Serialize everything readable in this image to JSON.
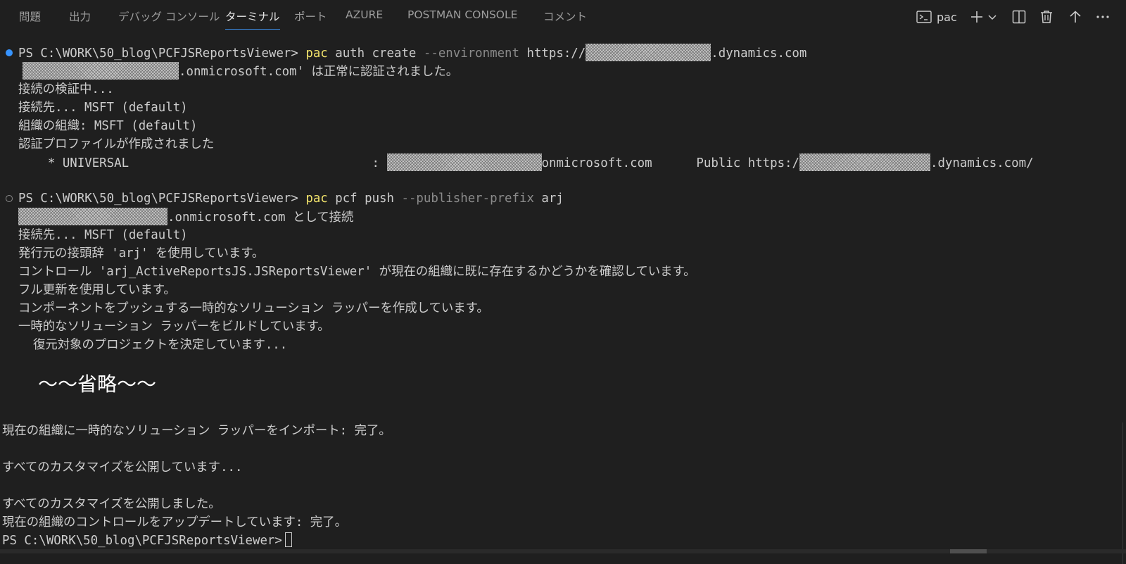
{
  "tabs": {
    "problems": "問題",
    "output": "出力",
    "debug_console": "デバッグ コンソール",
    "terminal": "ターミナル",
    "ports": "ポート",
    "azure": "AZURE",
    "postman_console": "POSTMAN CONSOLE",
    "comments": "コメント",
    "active": "terminal"
  },
  "toolbar": {
    "terminal_name": "pac",
    "icons": [
      "terminal-icon",
      "plus-icon",
      "chevron-down-icon",
      "split-icon",
      "trash-icon",
      "arrow-up-icon",
      "more-icon"
    ]
  },
  "terminal": {
    "block1": {
      "prompt": "PS C:\\WORK\\50_blog\\PCFJSReportsViewer> ",
      "cmd_exe": "pac",
      "cmd_rest": " auth create ",
      "cmd_param": "--environment",
      "url_prefix": " https://",
      "url_suffix": ".dynamics.com",
      "auth_suffix": ".onmicrosoft.com' は正常に認証されました。",
      "verifying": "接続の検証中...",
      "connected_to": "接続先... MSFT (default)",
      "org": "組織の組織: MSFT (default)",
      "profile_created": "認証プロファイルが作成されました",
      "profile_prefix": "    * UNIVERSAL                                 : ",
      "profile_domain": "onmicrosoft.com",
      "profile_public": "      Public https:/",
      "profile_url_suffix": ".dynamics.com/"
    },
    "block2": {
      "prompt": "PS C:\\WORK\\50_blog\\PCFJSReportsViewer> ",
      "cmd_exe": "pac",
      "cmd_rest": " pcf push ",
      "cmd_param": "--publisher-prefix",
      "cmd_arg": " arj",
      "connect_suffix": ".onmicrosoft.com として接続",
      "connected_to": "接続先... MSFT (default)",
      "prefix_use": "発行元の接頭辞 'arj' を使用しています。",
      "control_check": "コントロール 'arj_ActiveReportsJS.JSReportsViewer' が現在の組織に既に存在するかどうかを確認しています。",
      "full_update": "フル更新を使用しています。",
      "create_wrapper": "コンポーネントをプッシュする一時的なソリューション ラッパーを作成しています。",
      "build_wrapper": "一時的なソリューション ラッパーをビルドしています。",
      "restore": "  復元対象のプロジェクトを決定しています..."
    },
    "omitted": "〜〜省略〜〜",
    "import_done": "現在の組織に一時的なソリューション ラッパーをインポート: 完了。",
    "publishing": "すべてのカスタマイズを公開しています...",
    "published": "すべてのカスタマイズを公開しました。",
    "update_done": "現在の組織のコントロールをアップデートしています: 完了。",
    "final_prompt": "PS C:\\WORK\\50_blog\\PCFJSReportsViewer>"
  },
  "colors": {
    "background": "#1f1f1f",
    "text": "#cccccc",
    "command": "#f1e26b",
    "parameter": "#8b8b8b",
    "success_decoration": "#3794ff",
    "active_tab_underline": "#3b8eea"
  }
}
